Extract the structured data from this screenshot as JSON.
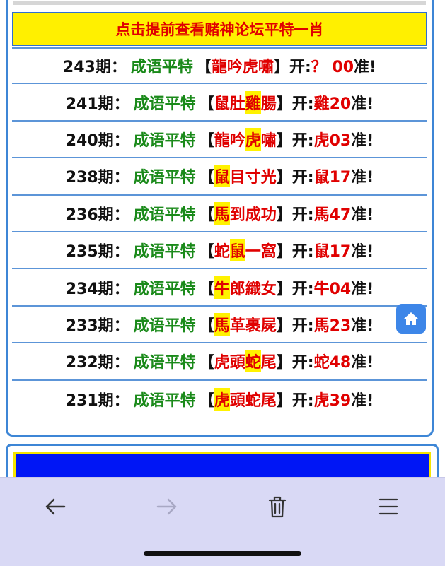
{
  "banner": {
    "text": "点击提前查看赌神论坛平特一肖"
  },
  "rows": [
    {
      "period": "243期：",
      "category": "成语平特",
      "open_bracket": "【",
      "idiom": [
        {
          "c": "龍",
          "h": false
        },
        {
          "c": "吟",
          "h": false
        },
        {
          "c": "虎",
          "h": false
        },
        {
          "c": "嘯",
          "h": false
        }
      ],
      "close_bracket": "】",
      "open_label": "开:",
      "result": "？ 00",
      "accurate": "准!"
    },
    {
      "period": "241期：",
      "category": "成语平特",
      "open_bracket": "【",
      "idiom": [
        {
          "c": "鼠",
          "h": false
        },
        {
          "c": "肚",
          "h": false
        },
        {
          "c": "雞",
          "h": true
        },
        {
          "c": "腸",
          "h": false
        }
      ],
      "close_bracket": "】",
      "open_label": "开:",
      "result": "雞20",
      "accurate": "准!"
    },
    {
      "period": "240期：",
      "category": "成语平特",
      "open_bracket": "【",
      "idiom": [
        {
          "c": "龍",
          "h": false
        },
        {
          "c": "吟",
          "h": false
        },
        {
          "c": "虎",
          "h": true
        },
        {
          "c": "嘯",
          "h": false
        }
      ],
      "close_bracket": "】",
      "open_label": "开:",
      "result": "虎03",
      "accurate": "准!"
    },
    {
      "period": "238期：",
      "category": "成语平特",
      "open_bracket": "【",
      "idiom": [
        {
          "c": "鼠",
          "h": true
        },
        {
          "c": "目",
          "h": false
        },
        {
          "c": "寸",
          "h": false
        },
        {
          "c": "光",
          "h": false
        }
      ],
      "close_bracket": "】",
      "open_label": "开:",
      "result": "鼠17",
      "accurate": "准!"
    },
    {
      "period": "236期：",
      "category": "成语平特",
      "open_bracket": "【",
      "idiom": [
        {
          "c": "馬",
          "h": true
        },
        {
          "c": "到",
          "h": false
        },
        {
          "c": "成",
          "h": false
        },
        {
          "c": "功",
          "h": false
        }
      ],
      "close_bracket": "】",
      "open_label": "开:",
      "result": "馬47",
      "accurate": "准!"
    },
    {
      "period": "235期：",
      "category": "成语平特",
      "open_bracket": "【",
      "idiom": [
        {
          "c": "蛇",
          "h": false
        },
        {
          "c": "鼠",
          "h": true
        },
        {
          "c": "一",
          "h": false
        },
        {
          "c": "窩",
          "h": false
        }
      ],
      "close_bracket": "】",
      "open_label": "开:",
      "result": "鼠17",
      "accurate": "准!"
    },
    {
      "period": "234期：",
      "category": "成语平特",
      "open_bracket": "【",
      "idiom": [
        {
          "c": "牛",
          "h": true
        },
        {
          "c": "郎",
          "h": false
        },
        {
          "c": "織",
          "h": false
        },
        {
          "c": "女",
          "h": false
        }
      ],
      "close_bracket": "】",
      "open_label": "开:",
      "result": "牛04",
      "accurate": "准!"
    },
    {
      "period": "233期：",
      "category": "成语平特",
      "open_bracket": "【",
      "idiom": [
        {
          "c": "馬",
          "h": true
        },
        {
          "c": "革",
          "h": false
        },
        {
          "c": "裹",
          "h": false
        },
        {
          "c": "屍",
          "h": false
        }
      ],
      "close_bracket": "】",
      "open_label": "开:",
      "result": "馬23",
      "accurate": "准!"
    },
    {
      "period": "232期：",
      "category": "成语平特",
      "open_bracket": "【",
      "idiom": [
        {
          "c": "虎",
          "h": false
        },
        {
          "c": "頭",
          "h": false
        },
        {
          "c": "蛇",
          "h": true
        },
        {
          "c": "尾",
          "h": false
        }
      ],
      "close_bracket": "】",
      "open_label": "开:",
      "result": "蛇48",
      "accurate": "准!"
    },
    {
      "period": "231期：",
      "category": "成语平特",
      "open_bracket": "【",
      "idiom": [
        {
          "c": "虎",
          "h": true
        },
        {
          "c": "頭",
          "h": false
        },
        {
          "c": "蛇",
          "h": false
        },
        {
          "c": "尾",
          "h": false
        }
      ],
      "close_bracket": "】",
      "open_label": "开:",
      "result": "虎39",
      "accurate": "准!"
    }
  ],
  "icons": {
    "home": "home-icon",
    "back": "arrow-left-icon",
    "forward": "arrow-right-icon",
    "delete": "trash-icon",
    "menu": "menu-icon"
  },
  "colors": {
    "banner_bg": "#fff000",
    "banner_text": "#e00000",
    "category_text": "#1a8a1a",
    "result_text": "#e00000",
    "border": "#3d86d6",
    "toolbar_bg": "#d9d9f5"
  }
}
